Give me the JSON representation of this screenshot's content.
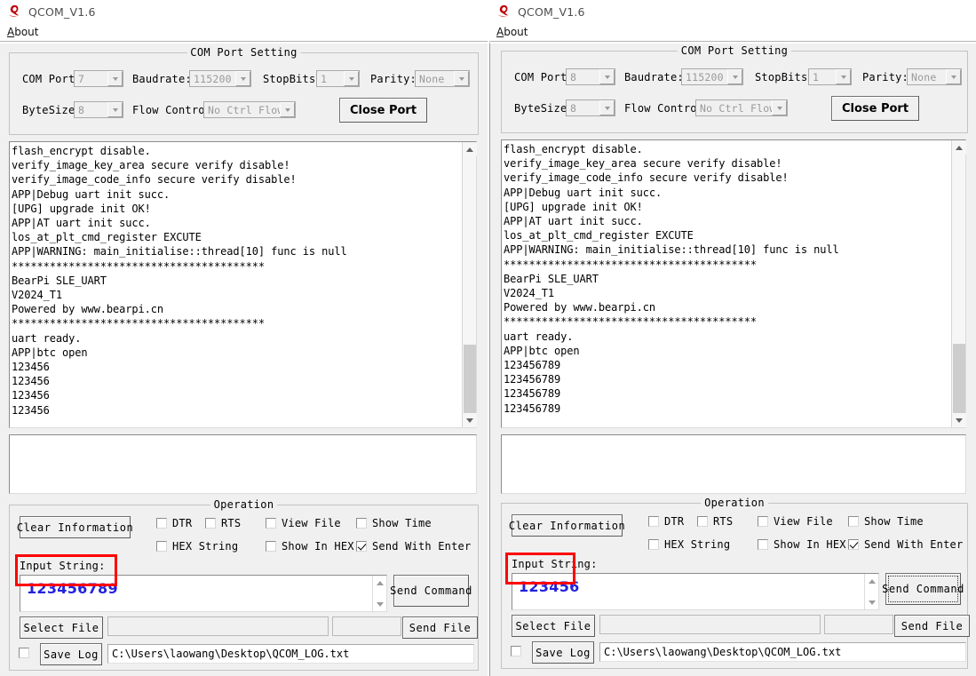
{
  "app": {
    "title": "QCOM_V1.6",
    "logo_icon": "qcom-q-logo-icon",
    "accent_red": "#cc0000",
    "annotation_red": "#ff0000",
    "input_blue": "#2222dd"
  },
  "menu": {
    "about": "About",
    "about_mnemonic": "A",
    "about_rest": "bout"
  },
  "labels": {
    "com_port_setting": "COM Port Setting",
    "operation": "Operation",
    "com_port": "COM Port:",
    "baudrate": "Baudrate:",
    "stopbits": "StopBits:",
    "parity": "Parity:",
    "bytesize": "ByteSize:",
    "flow_control": "Flow Control:",
    "input_string": "Input String:"
  },
  "buttons": {
    "close_port": "Close Port",
    "clear_information": "Clear Information",
    "send_command": "Send Command",
    "select_file": "Select File",
    "send_file": "Send File",
    "save_log": "Save Log"
  },
  "checkbox_labels": {
    "dtr": "DTR",
    "rts": "RTS",
    "view_file": "View File",
    "show_time": "Show Time",
    "hex_string": "HEX String",
    "show_in_hex": "Show In HEX",
    "send_with_enter": "Send With Enter"
  },
  "left_window": {
    "settings": {
      "com_port": "7",
      "baudrate": "115200",
      "stopbits": "1",
      "parity": "None",
      "bytesize": "8",
      "flow_control": "No Ctrl Flow"
    },
    "checkboxes": {
      "dtr": false,
      "rts": false,
      "view_file": false,
      "show_time": false,
      "hex_string": false,
      "show_in_hex": false,
      "send_with_enter": true,
      "save_log": false
    },
    "terminal_lines": [
      "flash_encrypt disable.",
      "verify_image_key_area secure verify disable!",
      "verify_image_code_info secure verify disable!",
      "APP|Debug uart init succ.",
      "[UPG] upgrade init OK!",
      "APP|AT uart init succ.",
      "los_at_plt_cmd_register EXCUTE",
      "APP|WARNING: main_initialise::thread[10] func is null",
      "****************************************",
      "BearPi SLE_UART",
      "V2024_T1",
      "Powered by www.bearpi.cn",
      "****************************************",
      "uart ready.",
      "APP|btc open",
      "123456",
      "123456",
      "123456",
      "123456"
    ],
    "secondary_panel_text": "",
    "input_string_value": "123456789",
    "file_path_value": "",
    "file_size_value": "",
    "log_path_value": "C:\\Users\\laowang\\Desktop\\QCOM_LOG.txt",
    "send_command_focused": false
  },
  "right_window": {
    "settings": {
      "com_port": "8",
      "baudrate": "115200",
      "stopbits": "1",
      "parity": "None",
      "bytesize": "8",
      "flow_control": "No Ctrl Flow"
    },
    "checkboxes": {
      "dtr": false,
      "rts": false,
      "view_file": false,
      "show_time": false,
      "hex_string": false,
      "show_in_hex": false,
      "send_with_enter": true,
      "save_log": false
    },
    "terminal_lines": [
      "flash_encrypt disable.",
      "verify_image_key_area secure verify disable!",
      "verify_image_code_info secure verify disable!",
      "APP|Debug uart init succ.",
      "[UPG] upgrade init OK!",
      "APP|AT uart init succ.",
      "los_at_plt_cmd_register EXCUTE",
      "APP|WARNING: main_initialise::thread[10] func is null",
      "****************************************",
      "BearPi SLE_UART",
      "V2024_T1",
      "Powered by www.bearpi.cn",
      "****************************************",
      "uart ready.",
      "APP|btc open",
      "123456789",
      "123456789",
      "123456789",
      "123456789"
    ],
    "secondary_panel_text": "",
    "input_string_value": "123456",
    "file_path_value": "",
    "file_size_value": "",
    "log_path_value": "C:\\Users\\laowang\\Desktop\\QCOM_LOG.txt",
    "send_command_focused": true
  }
}
